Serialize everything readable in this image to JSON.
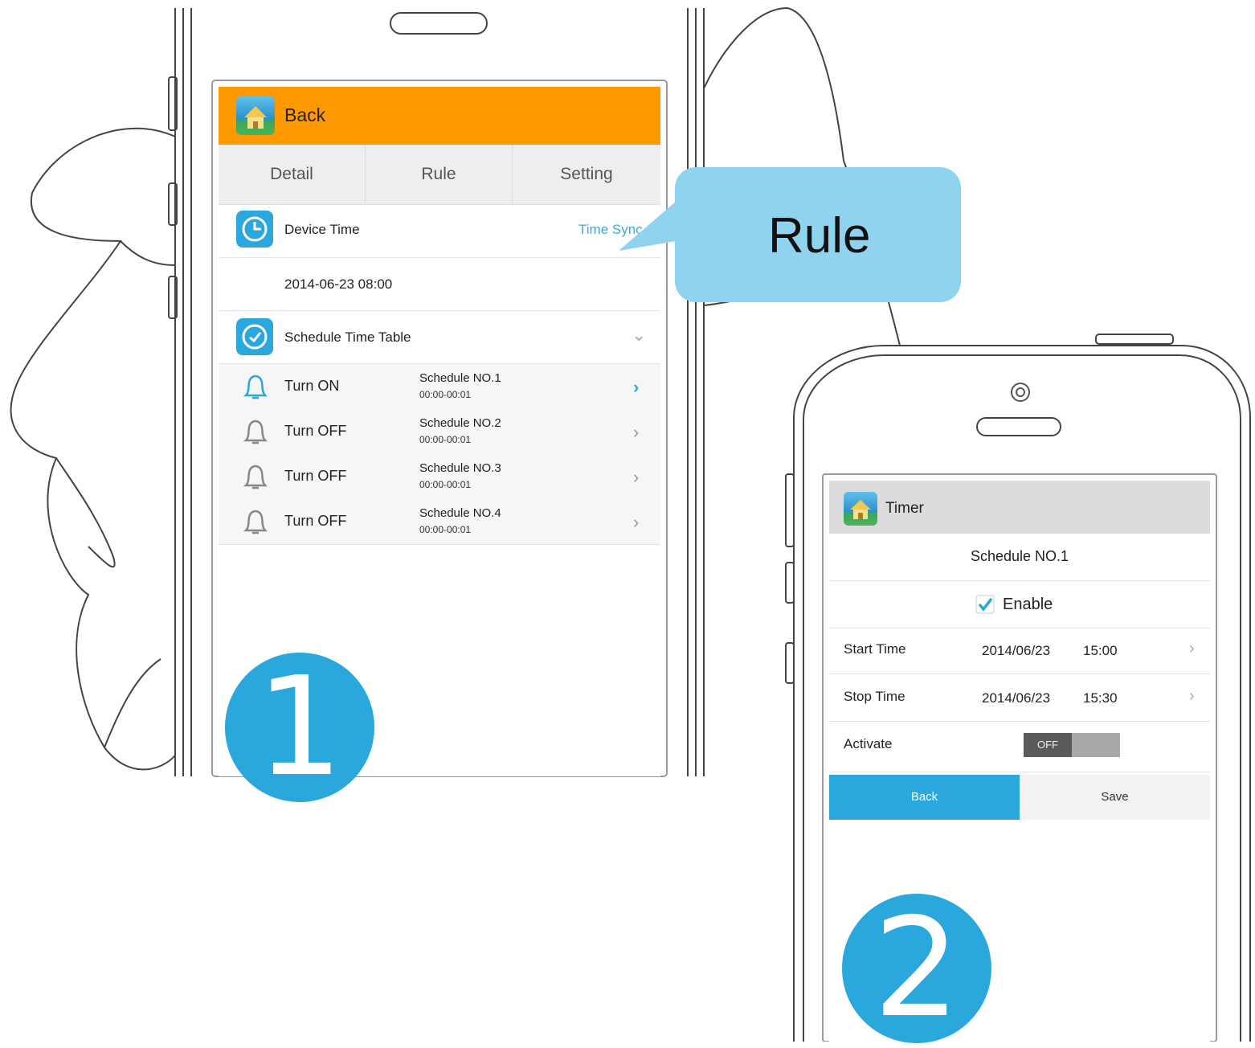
{
  "colors": {
    "accent": "#2aa7dc",
    "header_orange": "#ff9900",
    "callout": "#8fd3ef",
    "link": "#3aa9df"
  },
  "phone1": {
    "header": {
      "back_label": "Back"
    },
    "tabs": [
      {
        "label": "Detail"
      },
      {
        "label": "Rule"
      },
      {
        "label": "Setting"
      }
    ],
    "device_time": {
      "label": "Device Time",
      "sync_link": "Time Sync",
      "value": "2014-06-23 08:00"
    },
    "schedule_table": {
      "label": "Schedule Time Table",
      "rows": [
        {
          "state": "Turn ON",
          "name": "Schedule NO.1",
          "range": "00:00-00:01",
          "active": true
        },
        {
          "state": "Turn OFF",
          "name": "Schedule NO.2",
          "range": "00:00-00:01",
          "active": false
        },
        {
          "state": "Turn OFF",
          "name": "Schedule NO.3",
          "range": "00:00-00:01",
          "active": false
        },
        {
          "state": "Turn OFF",
          "name": "Schedule NO.4",
          "range": "00:00-00:01",
          "active": false
        }
      ]
    },
    "step_number": "1"
  },
  "callout": {
    "label": "Rule"
  },
  "phone2": {
    "header": {
      "title": "Timer"
    },
    "schedule_name": "Schedule NO.1",
    "enable_label": "Enable",
    "enable_checked": true,
    "start": {
      "label": "Start Time",
      "date": "2014/06/23",
      "time": "15:00"
    },
    "stop": {
      "label": "Stop Time",
      "date": "2014/06/23",
      "time": "15:30"
    },
    "activate": {
      "label": "Activate",
      "toggle": "OFF"
    },
    "buttons": {
      "back": "Back",
      "save": "Save"
    },
    "step_number": "2"
  },
  "icons": [
    "app-icon",
    "clock-icon",
    "schedule-clock-icon",
    "bell-icon",
    "chevron-right-icon",
    "chevron-down-icon",
    "checkbox-icon",
    "camera-icon"
  ]
}
